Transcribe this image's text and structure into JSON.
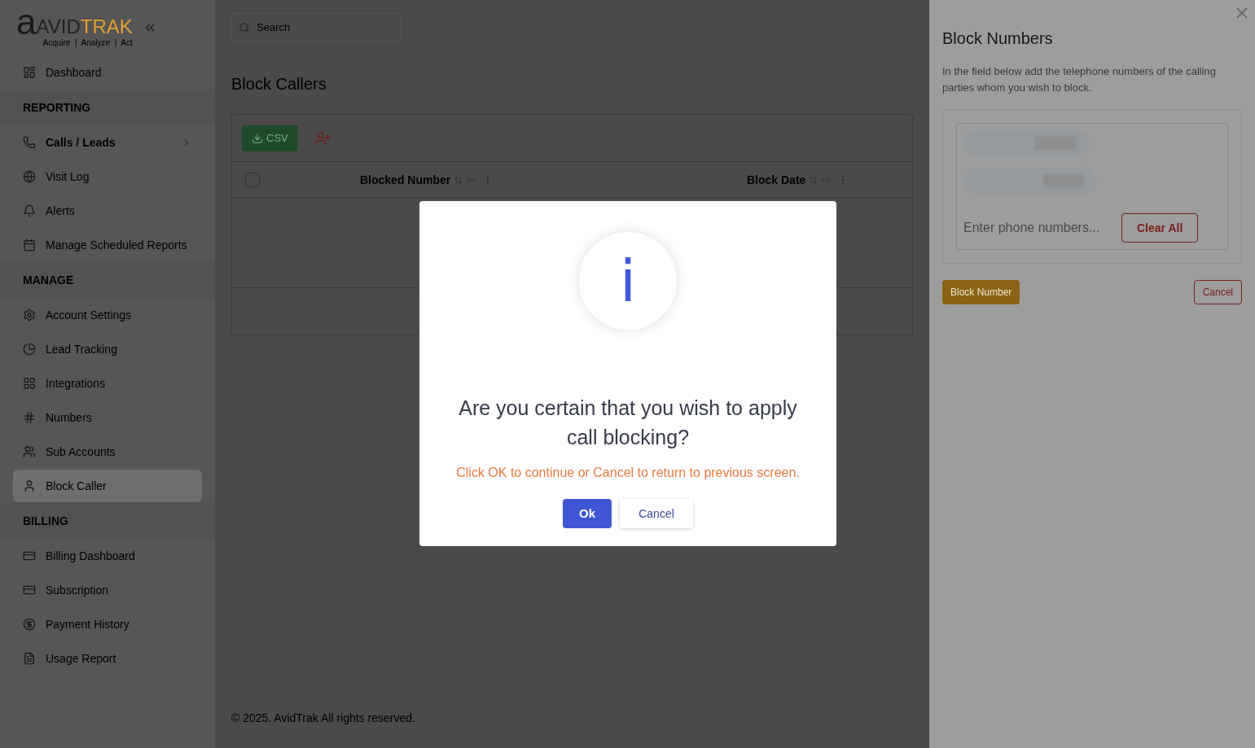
{
  "logo": {
    "mark": "a",
    "name_dark": "AVID",
    "name_accent": "TRAK",
    "tagline": "Acquire  |  Analyze  |  Act"
  },
  "search": {
    "placeholder": "Search"
  },
  "sidebar": [
    {
      "kind": "item",
      "label": "Dashboard",
      "selected": false
    },
    {
      "kind": "section",
      "label": "REPORTING"
    },
    {
      "kind": "item",
      "label": "Calls / Leads",
      "selected": false,
      "bold": true,
      "submenu": true
    },
    {
      "kind": "item",
      "label": "Visit Log",
      "selected": false
    },
    {
      "kind": "item",
      "label": "Alerts",
      "selected": false
    },
    {
      "kind": "item",
      "label": "Manage Scheduled Reports",
      "selected": false
    },
    {
      "kind": "section",
      "label": "MANAGE"
    },
    {
      "kind": "item",
      "label": "Account Settings",
      "selected": false
    },
    {
      "kind": "item",
      "label": "Lead Tracking",
      "selected": false
    },
    {
      "kind": "item",
      "label": "Integrations",
      "selected": false
    },
    {
      "kind": "item",
      "label": "Numbers",
      "selected": false
    },
    {
      "kind": "item",
      "label": "Sub Accounts",
      "selected": false
    },
    {
      "kind": "item",
      "label": "Block Caller",
      "selected": true
    },
    {
      "kind": "section",
      "label": "BILLING"
    },
    {
      "kind": "item",
      "label": "Billing Dashboard",
      "selected": false
    },
    {
      "kind": "item",
      "label": "Subscription",
      "selected": false
    },
    {
      "kind": "item",
      "label": "Payment History",
      "selected": false
    },
    {
      "kind": "item",
      "label": "Usage Report",
      "selected": false
    }
  ],
  "page_title": "Block Callers",
  "toolbar": {
    "csv_button": "CSV"
  },
  "table": {
    "select_all": {
      "checked": false
    },
    "columns": [
      "Blocked Number",
      "Block Date"
    ]
  },
  "footer": "© 2025. AvidTrak All rights reserved.",
  "panel": {
    "title": "Block Numbers",
    "description": "In the field below add the telephone numbers of the calling parties whom you wish to block.",
    "chips": [
      {
        "kind": "redacted"
      },
      {
        "kind": "redacted"
      }
    ],
    "placeholder": "Enter phone numbers...",
    "clear_button": "Clear All",
    "submit_button": "Block Number",
    "cancel_button": "Cancel"
  },
  "dialog": {
    "icon": "i",
    "title": "Are you certain that you wish to apply call blocking?",
    "message": "Click OK to continue or Cancel to return to previous screen.",
    "ok_button": "Ok",
    "cancel_button": "Cancel"
  }
}
